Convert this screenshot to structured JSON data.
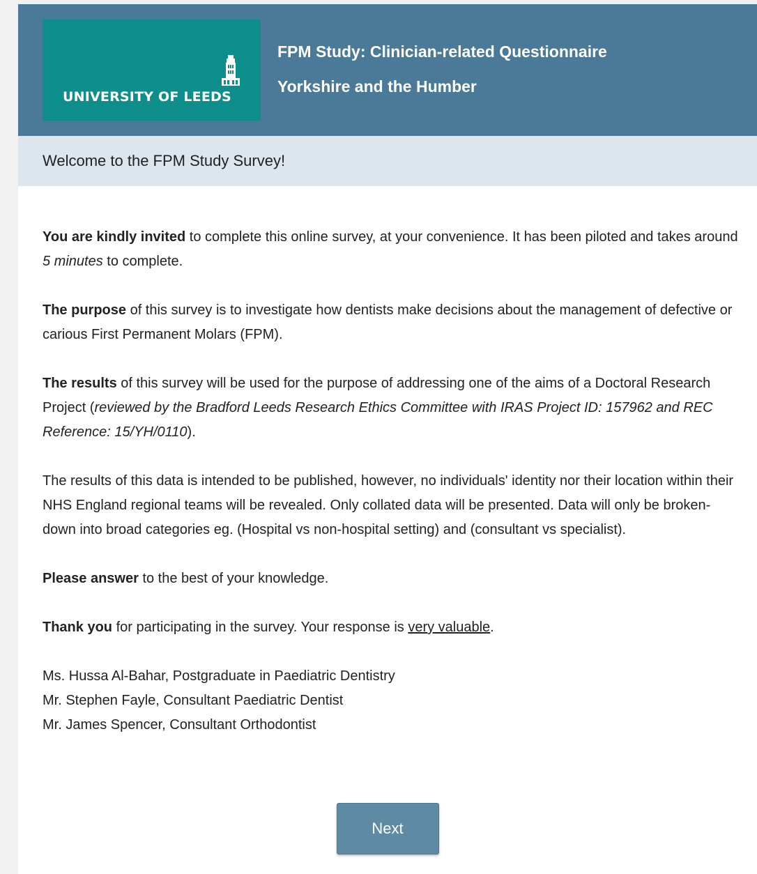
{
  "header": {
    "logo_text": "UNIVERSITY OF LEEDS",
    "title": "FPM Study: Clinician-related Questionnaire",
    "subtitle": "Yorkshire and the Humber"
  },
  "welcome": {
    "text": "Welcome to the FPM Study Survey!"
  },
  "content": {
    "p1_bold": "You are kindly invited",
    "p1_text_a": " to complete this online survey, at your convenience. It has been piloted and takes around ",
    "p1_italic": "5 minutes",
    "p1_text_b": " to complete.",
    "p2_bold": "The purpose",
    "p2_text": " of this survey is to investigate how dentists make decisions about the management of defective or carious First Permanent Molars (FPM).",
    "p3_bold": "The results",
    "p3_text_a": " of this survey will be used for the purpose of addressing one of the aims of a Doctoral Research Project (",
    "p3_italic": "reviewed by the Bradford Leeds Research Ethics Committee with IRAS Project ID: 157962 and REC Reference: 15/YH/0110",
    "p3_text_b": ").",
    "p4_text": "The results of this data is intended to be published, however, no individuals' identity nor their location within their NHS England regional teams will be revealed. Only collated data will be presented. Data will only be broken-down into broad categories eg. (Hospital vs non-hospital setting) and (consultant vs specialist).",
    "p5_bold": "Please answer",
    "p5_text": " to the best of your knowledge.",
    "p6_bold": "Thank you",
    "p6_text": " for participating in the survey. Your response is ",
    "p6_underline": "very valuable",
    "p6_end": "."
  },
  "signatures": [
    "Ms. Hussa Al-Bahar, Postgraduate in Paediatric Dentistry",
    "Mr. Stephen Fayle, Consultant Paediatric Dentist",
    "Mr. James Spencer, Consultant Orthodontist"
  ],
  "buttons": {
    "next_label": "Next"
  },
  "colors": {
    "header_bg": "#4a7a97",
    "logo_bg": "#0e8e8a",
    "welcome_bg": "#dde6ec",
    "button_bg": "#5e8aa3"
  }
}
